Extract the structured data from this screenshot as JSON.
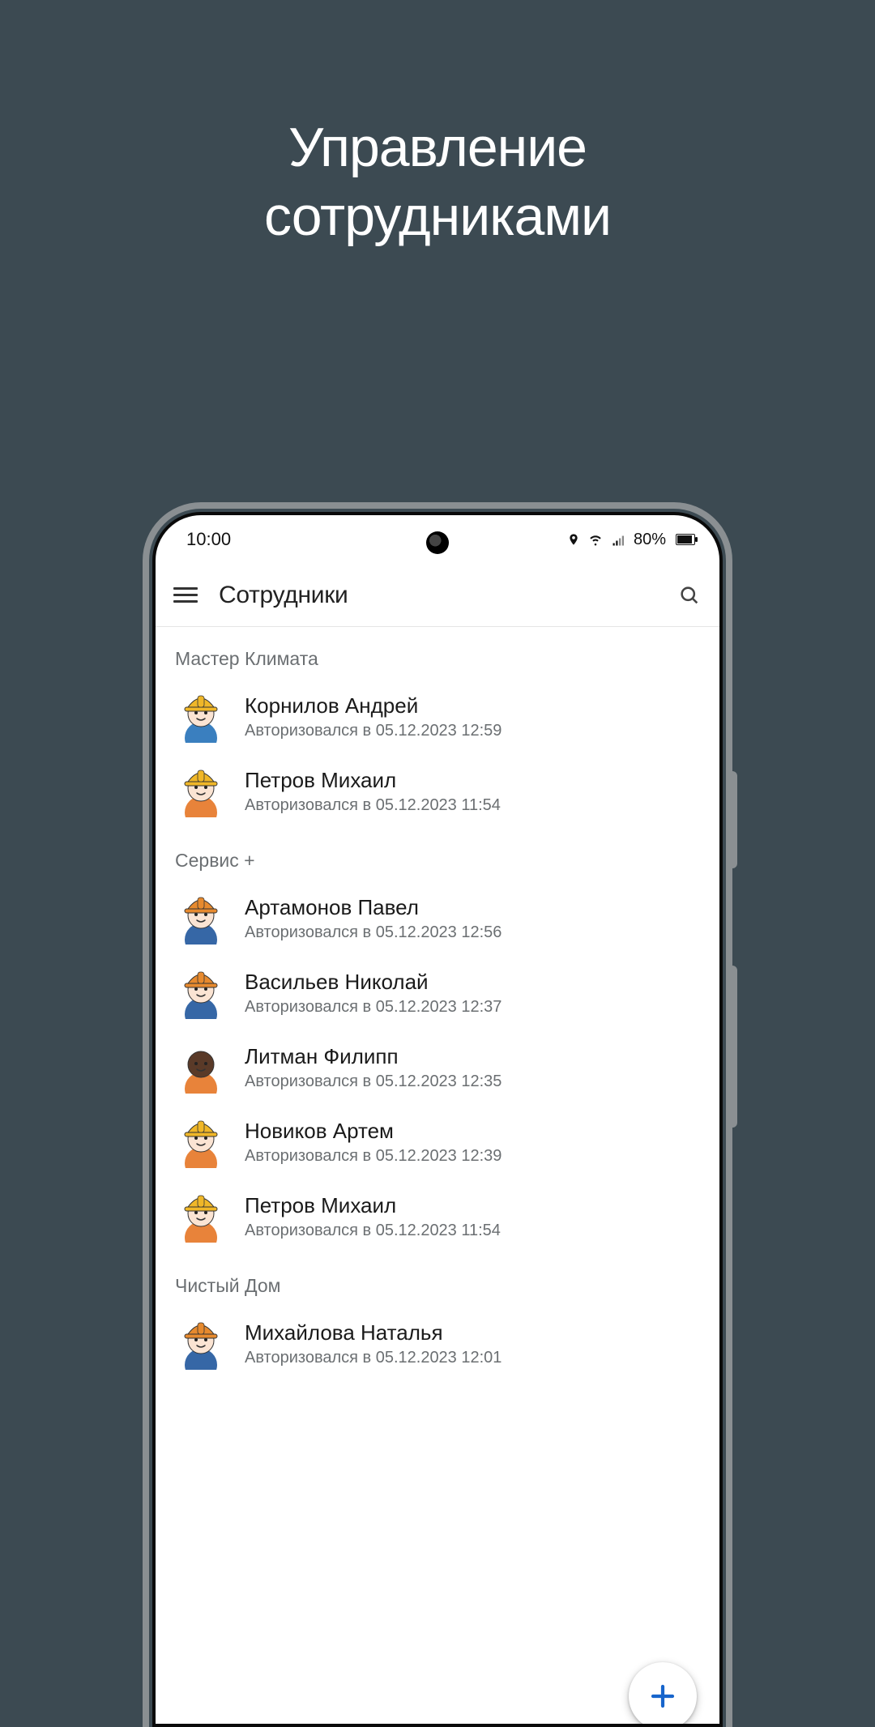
{
  "promo": {
    "line1": "Управление",
    "line2": "сотрудниками"
  },
  "statusbar": {
    "time": "10:00",
    "battery_text": "80%"
  },
  "appbar": {
    "title": "Сотрудники"
  },
  "fab": {
    "label": "+"
  },
  "avatar_styles": {
    "yellow_hat_blue": {
      "hat": "#f0b728",
      "skin": "#fbe4d3",
      "shirt": "#3a7fbf",
      "hair": "#8c5a2b"
    },
    "yellow_hat_overalls": {
      "hat": "#f0b728",
      "skin": "#fbe4d3",
      "shirt": "#e8833a",
      "hair": "#5a3a1a"
    },
    "orange_hat": {
      "hat": "#e78a2e",
      "skin": "#fbe4d3",
      "shirt": "#3667a6",
      "hair": "#5a3a1a"
    },
    "dark_skin": {
      "hat": "none",
      "skin": "#5a3a28",
      "shirt": "#e8833a",
      "hair": "#111"
    }
  },
  "groups": [
    {
      "title": "Мастер Климата",
      "items": [
        {
          "name": "Корнилов Андрей",
          "sub": "Авторизовался в 05.12.2023 12:59",
          "style": "yellow_hat_blue"
        },
        {
          "name": "Петров Михаил",
          "sub": "Авторизовался в 05.12.2023 11:54",
          "style": "yellow_hat_overalls"
        }
      ]
    },
    {
      "title": "Сервис +",
      "items": [
        {
          "name": "Артамонов Павел",
          "sub": "Авторизовался в 05.12.2023 12:56",
          "style": "orange_hat"
        },
        {
          "name": "Васильев Николай",
          "sub": "Авторизовался в 05.12.2023 12:37",
          "style": "orange_hat"
        },
        {
          "name": "Литман Филипп",
          "sub": "Авторизовался в 05.12.2023 12:35",
          "style": "dark_skin"
        },
        {
          "name": "Новиков Артем",
          "sub": "Авторизовался в 05.12.2023 12:39",
          "style": "yellow_hat_overalls"
        },
        {
          "name": "Петров Михаил",
          "sub": "Авторизовался в 05.12.2023 11:54",
          "style": "yellow_hat_overalls"
        }
      ]
    },
    {
      "title": "Чистый Дом",
      "items": [
        {
          "name": "Михайлова Наталья",
          "sub": "Авторизовался в 05.12.2023 12:01",
          "style": "orange_hat"
        }
      ]
    }
  ]
}
